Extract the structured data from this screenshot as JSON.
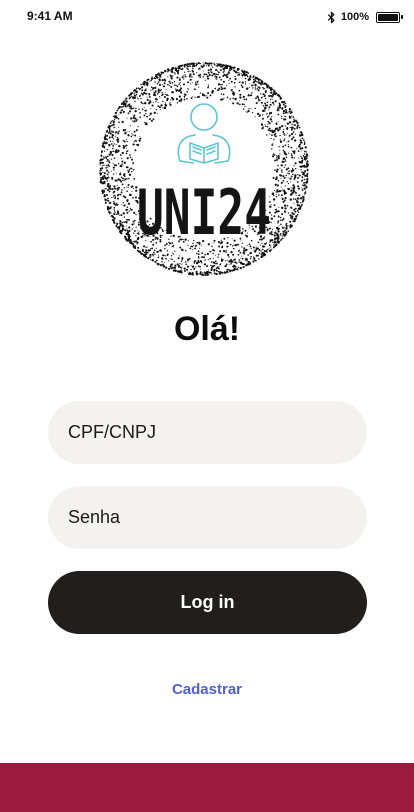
{
  "status_bar": {
    "time": "9:41 AM",
    "battery_percent": "100%",
    "bluetooth_icon": "bluetooth-icon",
    "battery_icon": "battery-full-icon"
  },
  "logo": {
    "text": "UNI24",
    "icon": "reader-with-book-icon",
    "ring_color": "#111111",
    "icon_color": "#5bc6d6"
  },
  "greeting": "Olá!",
  "form": {
    "cpf_placeholder": "CPF/CNPJ",
    "password_placeholder": "Senha",
    "login_label": "Log in",
    "register_label": "Cadastrar"
  },
  "colors": {
    "field_bg": "#f3f2f0",
    "button_bg": "#231e1e",
    "link": "#4f60cf",
    "footer": "#9b1b3e"
  }
}
